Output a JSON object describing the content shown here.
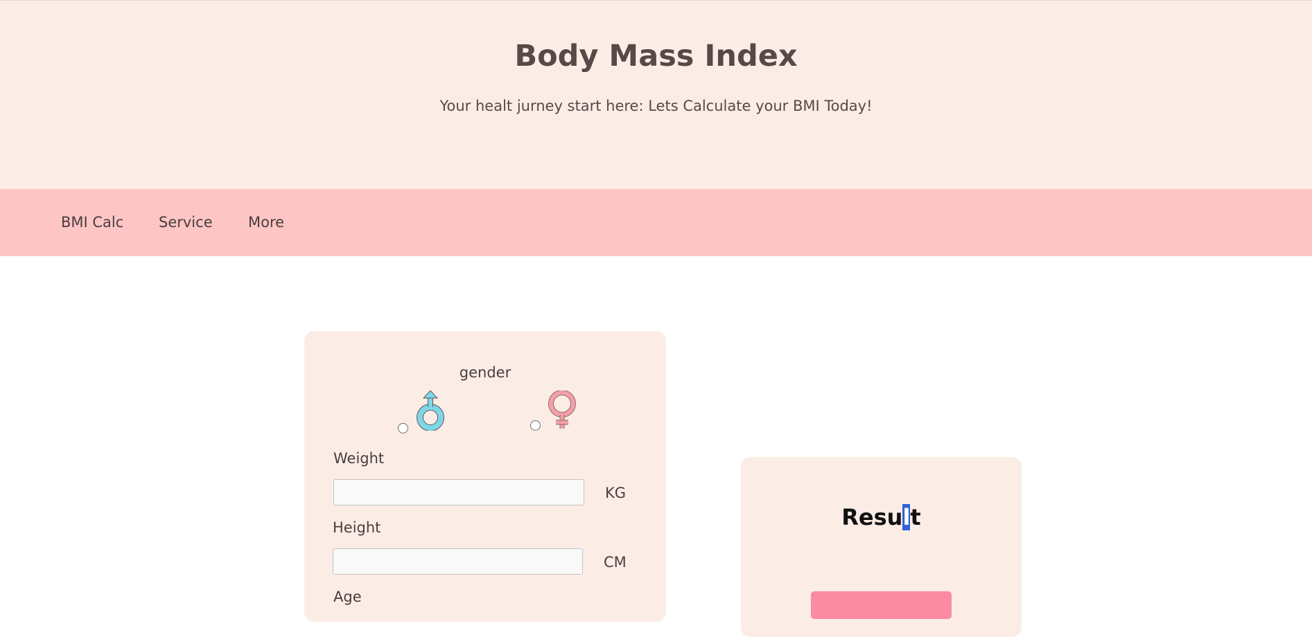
{
  "header": {
    "title": "Body Mass Index",
    "subtitle": "Your healt jurney start here: Lets Calculate your BMI Today!"
  },
  "nav": {
    "items": [
      {
        "label": "BMI Calc"
      },
      {
        "label": "Service"
      },
      {
        "label": "More"
      }
    ]
  },
  "form": {
    "gender_label": "gender",
    "gender_options": [
      {
        "icon": "male-symbol-icon",
        "color": "#7fd6e6",
        "selected": false
      },
      {
        "icon": "female-symbol-icon",
        "color": "#f2a0a8",
        "selected": false
      }
    ],
    "weight": {
      "label": "Weight",
      "value": "",
      "unit": "KG"
    },
    "height": {
      "label": "Height",
      "value": "",
      "unit": "CM"
    },
    "age": {
      "label": "Age"
    }
  },
  "result": {
    "title_before": "Resu",
    "title_selected": "l",
    "title_after": "t",
    "button_label": ""
  },
  "colors": {
    "hero_bg": "#fbede6",
    "nav_bg": "#fec5c5",
    "card_bg": "#fbede6",
    "button": "#fb8aa3",
    "text": "#4a3d3d"
  }
}
